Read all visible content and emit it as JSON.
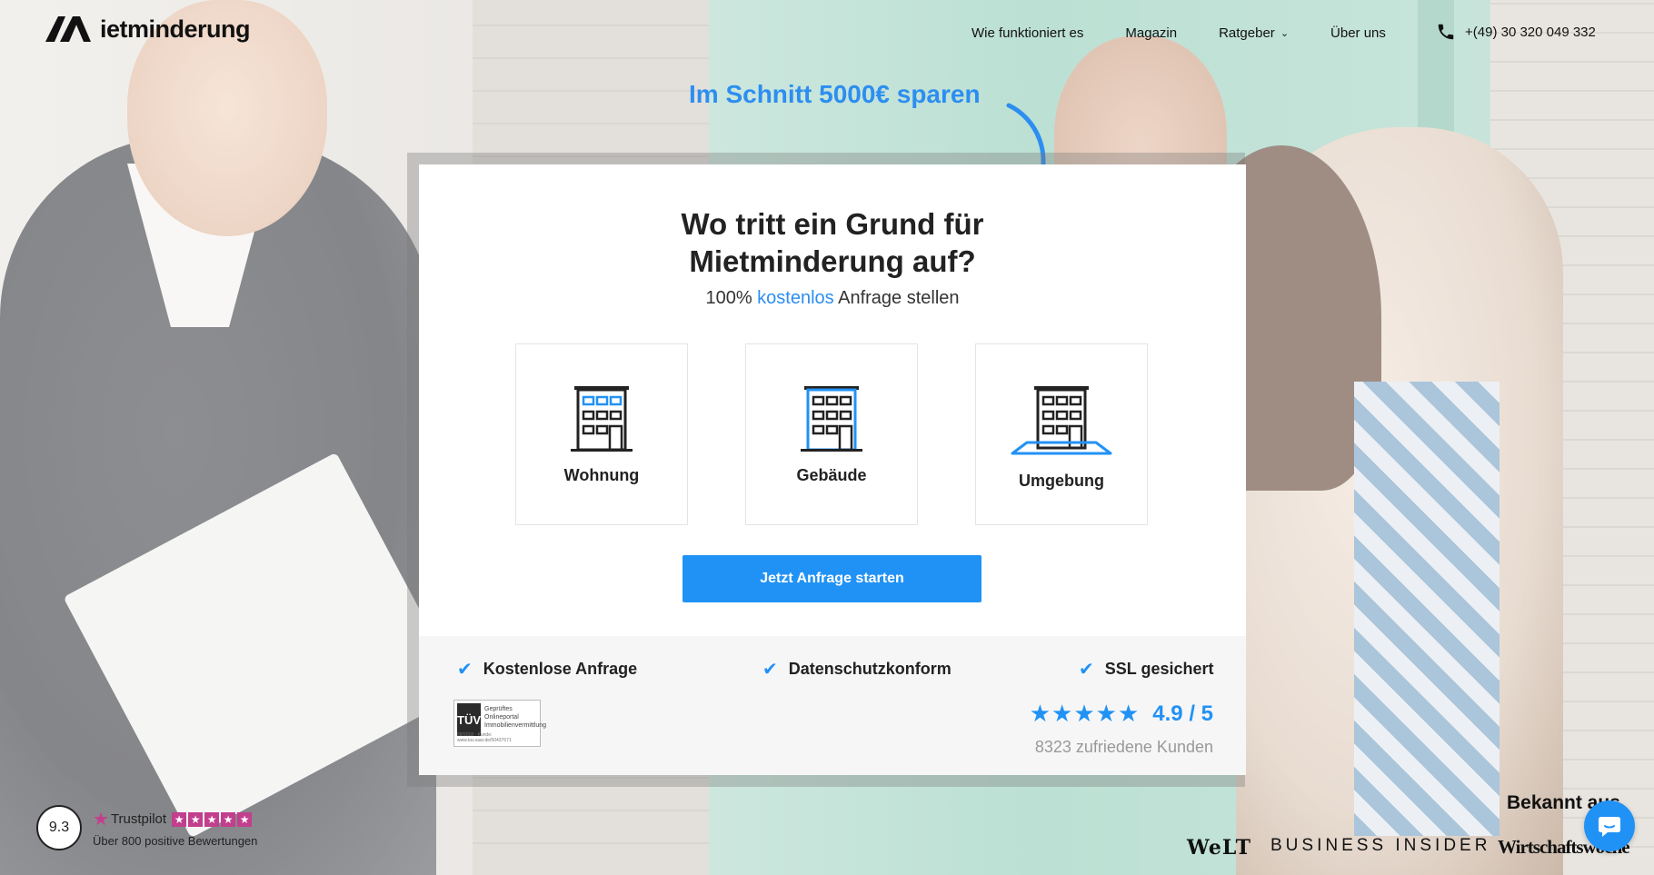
{
  "brand": {
    "logo_text": "ietminderung"
  },
  "nav": {
    "items": [
      {
        "label": "Wie funktioniert es"
      },
      {
        "label": "Magazin"
      },
      {
        "label": "Ratgeber",
        "has_dropdown": true
      },
      {
        "label": "Über uns"
      }
    ],
    "phone": "+(49) 30 320 049 332"
  },
  "hero": {
    "tagline": "Im Schnitt 5000€ sparen"
  },
  "card": {
    "title_line1": "Wo tritt ein Grund für",
    "title_line2": "Mietminderung auf?",
    "subtitle_prefix": "100% ",
    "subtitle_highlight": "kostenlos",
    "subtitle_suffix": " Anfrage stellen",
    "options": [
      {
        "label": "Wohnung",
        "icon": "building-apartment-icon"
      },
      {
        "label": "Gebäude",
        "icon": "building-outline-icon"
      },
      {
        "label": "Umgebung",
        "icon": "building-surroundings-icon"
      }
    ],
    "cta_label": "Jetzt Anfrage starten",
    "checks": [
      "Kostenlose Anfrage",
      "Datenschutzkonform",
      "SSL gesichert"
    ],
    "tuv": {
      "mark": "TÜV",
      "region": "SAARLAND",
      "line1": "Geprüftes",
      "line2": "Onlineportal",
      "line3": "Immobilienvermittlung",
      "footer": "09/2018 · Kunde: www.tuv.saar.de/50437671"
    },
    "rating": {
      "score": "4.9 / 5",
      "customers": "8323 zufriedene Kunden"
    }
  },
  "trustpilot": {
    "score": "9.3",
    "brand": "Trustpilot",
    "reviews": "Über 800 positive Bewertungen"
  },
  "press": {
    "heading": "Bekannt aus",
    "logos": [
      "WeLT",
      "BUSINESS INSIDER",
      "Wirtschaftswoche"
    ]
  },
  "colors": {
    "accent": "#2192f5",
    "tagline": "#2c8ef0",
    "trustpilot": "#c13f8d"
  }
}
